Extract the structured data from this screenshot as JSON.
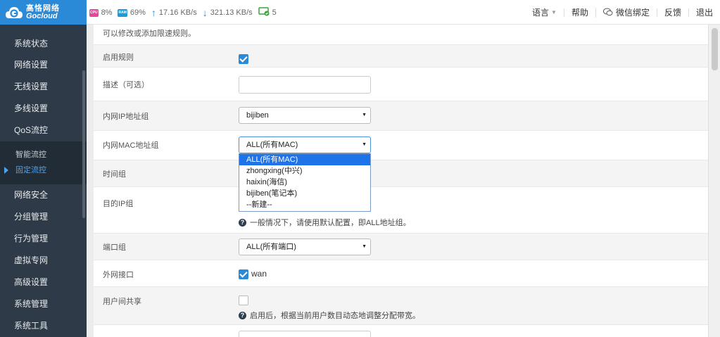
{
  "brand": {
    "name_cn": "高恪网络",
    "name_en": "Gocloud"
  },
  "stats": {
    "cpu_label": "CPU",
    "cpu": "8%",
    "ram_label": "RAM",
    "ram": "69%",
    "upload": "17.16 KB/s",
    "download": "321.13 KB/s",
    "devices": "5"
  },
  "topnav": {
    "language": "语言",
    "help": "帮助",
    "wechat": "微信绑定",
    "feedback": "反馈",
    "logout": "退出"
  },
  "sidebar": {
    "items": [
      {
        "label": "系统状态"
      },
      {
        "label": "网络设置"
      },
      {
        "label": "无线设置"
      },
      {
        "label": "多线设置"
      },
      {
        "label": "QoS流控"
      }
    ],
    "sub": [
      {
        "label": "智能流控"
      },
      {
        "label": "固定流控"
      }
    ],
    "items2": [
      {
        "label": "网络安全"
      },
      {
        "label": "分组管理"
      },
      {
        "label": "行为管理"
      },
      {
        "label": "虚拟专网"
      },
      {
        "label": "高级设置"
      },
      {
        "label": "系统管理"
      },
      {
        "label": "系统工具"
      }
    ]
  },
  "form": {
    "intro": "可以修改或添加限速规则。",
    "enable_rule": "启用规则",
    "description": "描述（可选）",
    "ip_group": "内网IP地址组",
    "ip_group_value": "bijiben",
    "mac_group": "内网MAC地址组",
    "mac_group_value": "ALL(所有MAC)",
    "mac_options": [
      "ALL(所有MAC)",
      "zhongxing(中兴)",
      "haixin(海信)",
      "bijiben(笔记本)",
      "--新建--"
    ],
    "time_group": "时间组",
    "dest_ip": "目的IP组",
    "dest_ip_hint": "一般情况下，请使用默认配置，即ALL地址组。",
    "port_group": "端口组",
    "port_group_value": "ALL(所有端口)",
    "wan_interface": "外网接口",
    "wan_value": "wan",
    "share": "用户间共享",
    "share_hint": "启用后，根据当前用户数目动态地调整分配带宽。"
  }
}
